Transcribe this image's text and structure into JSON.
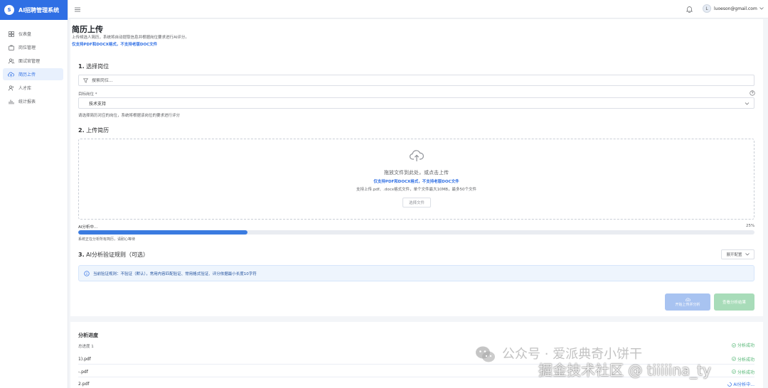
{
  "app": {
    "logo_letter": "S",
    "name": "AI招聘管理系统"
  },
  "sidebar": {
    "items": [
      {
        "label": "仪表盘",
        "icon": "dashboard-icon",
        "active": false
      },
      {
        "label": "岗位管理",
        "icon": "briefcase-icon",
        "active": false
      },
      {
        "label": "面试官管理",
        "icon": "users-icon",
        "active": false
      },
      {
        "label": "简历上传",
        "icon": "cloud-upload-icon",
        "active": true
      },
      {
        "label": "人才库",
        "icon": "people-icon",
        "active": false
      },
      {
        "label": "统计报表",
        "icon": "report-icon",
        "active": false
      }
    ]
  },
  "header": {
    "user_initial": "L",
    "user_email": "luoeson@gmail.com"
  },
  "page": {
    "title": "简历上传",
    "description": "上传候选人简历，系统将自动提取信息并根据岗位要求进行AI评分。",
    "warning": "仅支持PDF和DOCX格式，不支持老版DOC文件"
  },
  "step1": {
    "num": "1.",
    "title": "选择岗位",
    "search_placeholder": "搜索岗位...",
    "field_label": "目标岗位 *",
    "selected_value": "技术支持",
    "hint": "请选择简历对应的岗位，系统将根据该岗位的要求进行评分"
  },
  "step2": {
    "num": "2.",
    "title": "上传简历",
    "drop_text": "拖放文件到此处，或点击上传",
    "drop_warning": "仅支持PDF和DOCX格式，不支持老版DOC文件",
    "drop_note": "支持上传.pdf、.docx格式文件，单个文件最大10MB，最多50个文件",
    "select_button": "选择文件"
  },
  "progress": {
    "label": "AI分析中...",
    "percent_text": "25%",
    "value": 0.25,
    "hint": "系统正在分析所有简历，请耐心等待"
  },
  "step3": {
    "num": "3.",
    "title": "AI分析验证规则（可选）",
    "expand_button": "展开配置",
    "info": "当前验证规则：不验证（默认），常用内容匹配验证、常用格式验证、评分依据最小长度10字符"
  },
  "actions": {
    "analyze_label": "开始上传并分析",
    "view_label": "查看分析结果"
  },
  "analysis": {
    "title": "分析进度",
    "head_text": "总进度 1",
    "rows": [
      {
        "name": "1).pdf",
        "status": "分析成功"
      },
      {
        "name": "-.pdf",
        "status": "分析成功"
      },
      {
        "name": "2.pdf",
        "status": "AI分析中..."
      }
    ],
    "extra_status": "分析成功"
  },
  "watermark": {
    "line1": "公众号 · 爱派典奇小饼干",
    "line2": "掘金技术社区 @ tiiiiina_ty"
  },
  "colors": {
    "primary": "#2f6fe4",
    "success": "#52b573",
    "sidebar_active_bg": "#e8f0fd"
  }
}
